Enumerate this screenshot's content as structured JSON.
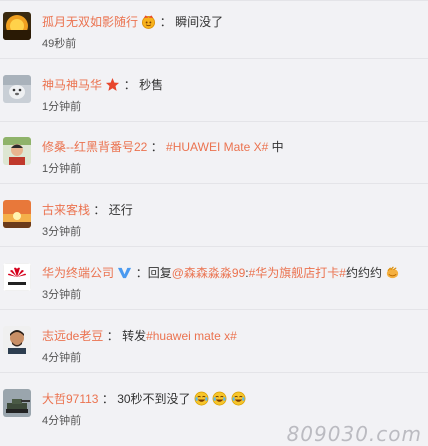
{
  "comments": [
    {
      "user": "孤月无双如影随行",
      "sep": "：",
      "text": "瞬间没了",
      "time": "49秒前",
      "avatar_icon": "sunset-avatar",
      "badge_icon": "crown-face-emoji"
    },
    {
      "user": "神马神马华",
      "sep": "：",
      "text": "秒售",
      "time": "1分钟前",
      "avatar_icon": "pet-photo-avatar",
      "badge_icon": "red-star-icon"
    },
    {
      "user": "修桑--红黑背番号22",
      "sep": "：",
      "tag": "#HUAWEI Mate X#",
      "text_after": " 中",
      "time": "1分钟前",
      "avatar_icon": "person-photo-avatar"
    },
    {
      "user": "古来客栈",
      "sep": "：",
      "text": "还行",
      "time": "3分钟前",
      "avatar_icon": "sunset-sky-avatar"
    },
    {
      "user": "华为终端公司",
      "sep": "：",
      "text_before": "回复",
      "mention": "@森森淼淼99",
      "text_mid": ":",
      "tag": "#华为旗舰店打卡#",
      "text_after": "约约约",
      "time": "3分钟前",
      "avatar_icon": "huawei-logo-avatar",
      "badge_icon": "verified-v-icon",
      "end_icon": "clapping-hand-emoji"
    },
    {
      "user": "志远de老豆",
      "sep": "：",
      "text_before": "转发",
      "tag": "#huawei mate x#",
      "time": "4分钟前",
      "avatar_icon": "man-portrait-avatar"
    },
    {
      "user": "大哲97113",
      "sep": "：",
      "text": "30秒不到没了",
      "time": "4分钟前",
      "avatar_icon": "tank-photo-avatar",
      "emojis": [
        "laugh-cry-emoji",
        "laugh-cry-emoji",
        "laugh-cry-emoji"
      ]
    }
  ],
  "watermark": {
    "text": "809030.com"
  },
  "colors": {
    "link": "#eb7350",
    "text": "#333333",
    "background": "#f2f2f5"
  }
}
